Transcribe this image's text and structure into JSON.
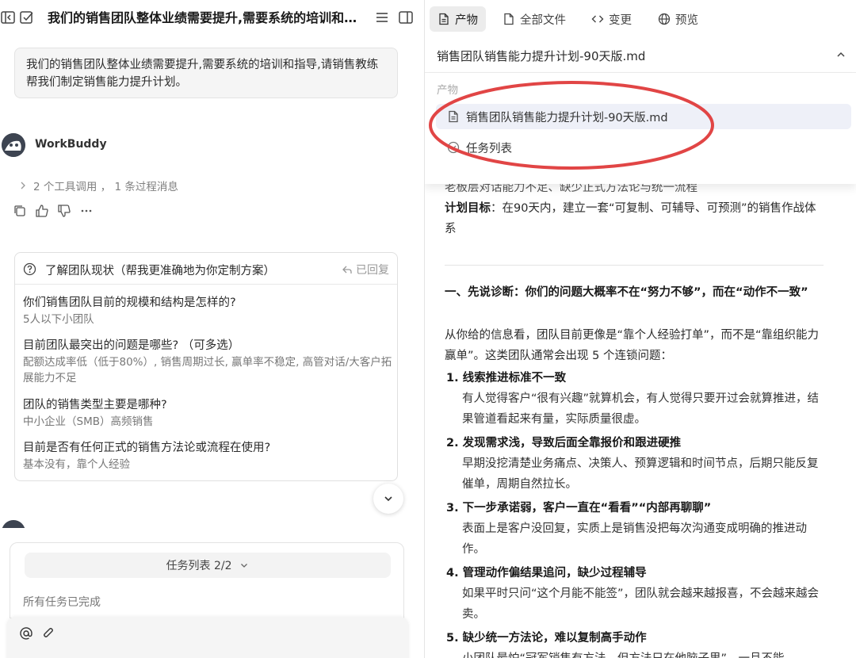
{
  "left": {
    "title": "我们的销售团队整体业绩需要提升,需要系统的培训和指导,请销售教练帮我们制定销售能力提升计划。",
    "user_message": "我们的销售团队整体业绩需要提升,需要系统的培训和指导,请销售教练帮我们制定销售能力提升计划。",
    "agent_name": "WorkBuddy",
    "process_summary": "2 个工具调用 ， 1 条过程消息",
    "card": {
      "title": "了解团队现状（帮我更准确地为你定制方案）",
      "status": "已回复",
      "qa": [
        {
          "q": "你们销售团队目前的规模和结构是怎样的?",
          "a": "5人以下小团队"
        },
        {
          "q": "目前团队最突出的问题是哪些? （可多选）",
          "a": "配额达成率低（低于80%）, 销售周期过长, 赢单率不稳定, 高管对话/大客户拓展能力不足"
        },
        {
          "q": "团队的销售类型主要是哪种?",
          "a": "中小企业（SMB）高频销售"
        },
        {
          "q": "目前是否有任何正式的销售方法论或流程在使用?",
          "a": "基本没有，靠个人经验"
        }
      ]
    },
    "task_list_label": "任务列表 2/2",
    "task_done": "所有任务已完成"
  },
  "right": {
    "tabs": [
      {
        "label": "产物",
        "icon": "file-icon",
        "active": true
      },
      {
        "label": "全部文件",
        "icon": "document-icon",
        "active": false
      },
      {
        "label": "变更",
        "icon": "code-icon",
        "active": false
      },
      {
        "label": "预览",
        "icon": "globe-icon",
        "active": false
      }
    ],
    "file_name": "销售团队销售能力提升计划-90天版.md",
    "dropdown": {
      "section": "产物",
      "items": [
        {
          "label": "销售团队销售能力提升计划-90天版.md",
          "icon": "file-icon",
          "selected": true
        },
        {
          "label": "任务列表",
          "icon": "check-circle-icon",
          "selected": false
        }
      ]
    },
    "doc": {
      "clipped_line": "老板层对话能力不足、缺少正式方法论与统一流程",
      "goal_label": "计划目标",
      "goal_text": "：在90天内，建立一套“可复制、可辅导、可预测”的销售作战体系",
      "section_title": "一、先说诊断：你们的问题大概率不在“努力不够”，而在“动作不一致”",
      "intro": "从你给的信息看，团队目前更像是“靠个人经验打单”，而不是“靠组织能力赢单”。这类团队通常会出现 5 个连锁问题：",
      "items": [
        {
          "n": "1.",
          "title": "线索推进标准不一致",
          "desc": "有人觉得客户“很有兴趣”就算机会，有人觉得只要开过会就算推进，结果管道看起来有量，实际质量很虚。"
        },
        {
          "n": "2.",
          "title": "发现需求浅，导致后面全靠报价和跟进硬推",
          "desc": "早期没挖清楚业务痛点、决策人、预算逻辑和时间节点，后期只能反复催单，周期自然拉长。"
        },
        {
          "n": "3.",
          "title": "下一步承诺弱，客户一直在“看看”“内部再聊聊”",
          "desc": "表面上是客户没回复，实质上是销售没把每次沟通变成明确的推进动作。"
        },
        {
          "n": "4.",
          "title": "管理动作偏结果追问，缺少过程辅导",
          "desc": "如果平时只问“这个月能不能签”，团队就会越来越报喜，不会越来越会卖。"
        },
        {
          "n": "5.",
          "title": "缺少统一方法论，难以复制高手动作",
          "desc": "小团队最怕“冠军销售有方法，但方法只在他脑子里”，一旦不能"
        }
      ]
    }
  }
}
